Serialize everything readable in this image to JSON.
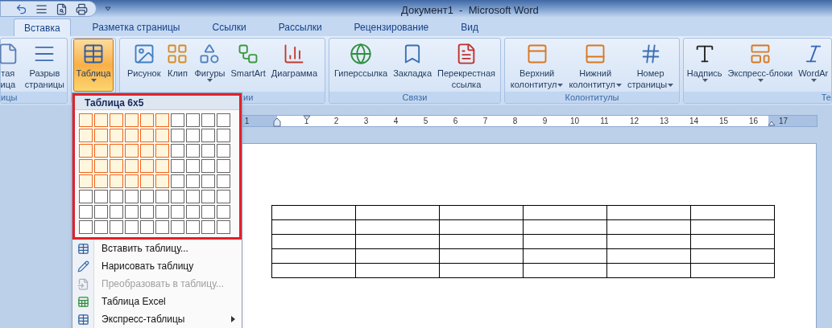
{
  "title_bar": {
    "title": "Документ1  -  Microsoft Word"
  },
  "tabs": [
    {
      "label": "Вставка",
      "selected": true
    },
    {
      "label": "Разметка страницы",
      "selected": false
    },
    {
      "label": "Ссылки",
      "selected": false
    },
    {
      "label": "Рассылки",
      "selected": false
    },
    {
      "label": "Рецензирование",
      "selected": false
    },
    {
      "label": "Вид",
      "selected": false
    }
  ],
  "ribbon": {
    "groups": [
      {
        "label": "ицы",
        "buttons": [
          {
            "lines": [
              "тая",
              "ица"
            ],
            "kind": "plain",
            "pressed": false
          },
          {
            "lines": [
              "Разрыв",
              "страницы"
            ],
            "kind": "plain",
            "pressed": false
          }
        ]
      },
      {
        "buttons": [
          {
            "lines": [
              "Таблица"
            ],
            "kind": "dropdown",
            "pressed": true
          }
        ]
      },
      {
        "label": "ии",
        "buttons": [
          {
            "lines": [
              "Рисунок"
            ],
            "kind": "plain",
            "pressed": false
          },
          {
            "lines": [
              "Клип"
            ],
            "kind": "plain",
            "pressed": false
          },
          {
            "lines": [
              "Фигуры"
            ],
            "kind": "dropdown",
            "pressed": false
          },
          {
            "lines": [
              "SmartArt"
            ],
            "kind": "plain",
            "pressed": false
          },
          {
            "lines": [
              "Диаграмма"
            ],
            "kind": "plain",
            "pressed": false
          }
        ]
      },
      {
        "label": "Связи",
        "buttons": [
          {
            "lines": [
              "Гиперссылка"
            ],
            "kind": "plain",
            "pressed": false
          },
          {
            "lines": [
              "Закладка"
            ],
            "kind": "plain",
            "pressed": false
          },
          {
            "lines": [
              "Перекрестная",
              "ссылка"
            ],
            "kind": "plain",
            "pressed": false
          }
        ]
      },
      {
        "label": "Колонтитулы",
        "buttons": [
          {
            "lines": [
              "Верхний",
              "колонтитул"
            ],
            "kind": "split",
            "pressed": false
          },
          {
            "lines": [
              "Нижний",
              "колонтитул"
            ],
            "kind": "split",
            "pressed": false
          },
          {
            "lines": [
              "Номер",
              "страницы"
            ],
            "kind": "split",
            "pressed": false
          }
        ]
      },
      {
        "label": "Те",
        "buttons": [
          {
            "lines": [
              "Надпись"
            ],
            "kind": "dropdown",
            "pressed": false
          },
          {
            "lines": [
              "Экспресс-блоки"
            ],
            "kind": "dropdown",
            "pressed": false
          },
          {
            "lines": [
              "WordAr"
            ],
            "kind": "dropdown",
            "pressed": false
          }
        ]
      }
    ]
  },
  "ruler": {
    "labels": [
      "1",
      "1",
      "2",
      "3",
      "4",
      "5",
      "6",
      "7",
      "8",
      "9",
      "10",
      "11",
      "12",
      "13",
      "14",
      "15",
      "16",
      "17"
    ]
  },
  "table_menu": {
    "header": "Таблица 6x5",
    "grid_rows": [
      {
        "cells": [
          {
            "selected": true
          },
          {
            "selected": true
          },
          {
            "selected": true
          },
          {
            "selected": true
          },
          {
            "selected": true
          },
          {
            "selected": true
          },
          {
            "selected": false
          },
          {
            "selected": false
          },
          {
            "selected": false
          },
          {
            "selected": false
          }
        ]
      },
      {
        "cells": [
          {
            "selected": true
          },
          {
            "selected": true
          },
          {
            "selected": true
          },
          {
            "selected": true
          },
          {
            "selected": true
          },
          {
            "selected": true
          },
          {
            "selected": false
          },
          {
            "selected": false
          },
          {
            "selected": false
          },
          {
            "selected": false
          }
        ]
      },
      {
        "cells": [
          {
            "selected": true
          },
          {
            "selected": true
          },
          {
            "selected": true
          },
          {
            "selected": true
          },
          {
            "selected": true
          },
          {
            "selected": true
          },
          {
            "selected": false
          },
          {
            "selected": false
          },
          {
            "selected": false
          },
          {
            "selected": false
          }
        ]
      },
      {
        "cells": [
          {
            "selected": true
          },
          {
            "selected": true
          },
          {
            "selected": true
          },
          {
            "selected": true
          },
          {
            "selected": true
          },
          {
            "selected": true
          },
          {
            "selected": false
          },
          {
            "selected": false
          },
          {
            "selected": false
          },
          {
            "selected": false
          }
        ]
      },
      {
        "cells": [
          {
            "selected": true
          },
          {
            "selected": true
          },
          {
            "selected": true
          },
          {
            "selected": true
          },
          {
            "selected": true
          },
          {
            "selected": true
          },
          {
            "selected": false
          },
          {
            "selected": false
          },
          {
            "selected": false
          },
          {
            "selected": false
          }
        ]
      },
      {
        "cells": [
          {
            "selected": false
          },
          {
            "selected": false
          },
          {
            "selected": false
          },
          {
            "selected": false
          },
          {
            "selected": false
          },
          {
            "selected": false
          },
          {
            "selected": false
          },
          {
            "selected": false
          },
          {
            "selected": false
          },
          {
            "selected": false
          }
        ]
      },
      {
        "cells": [
          {
            "selected": false
          },
          {
            "selected": false
          },
          {
            "selected": false
          },
          {
            "selected": false
          },
          {
            "selected": false
          },
          {
            "selected": false
          },
          {
            "selected": false
          },
          {
            "selected": false
          },
          {
            "selected": false
          },
          {
            "selected": false
          }
        ]
      },
      {
        "cells": [
          {
            "selected": false
          },
          {
            "selected": false
          },
          {
            "selected": false
          },
          {
            "selected": false
          },
          {
            "selected": false
          },
          {
            "selected": false
          },
          {
            "selected": false
          },
          {
            "selected": false
          },
          {
            "selected": false
          },
          {
            "selected": false
          }
        ]
      }
    ],
    "items": [
      {
        "label": "Вставить таблицу...",
        "disabled": false,
        "submenu": false
      },
      {
        "label": "Нарисовать таблицу",
        "disabled": false,
        "submenu": false
      },
      {
        "label": "Преобразовать в таблицу...",
        "disabled": true,
        "submenu": false
      },
      {
        "label": "Таблица Excel",
        "disabled": false,
        "submenu": false
      },
      {
        "label": "Экспресс-таблицы",
        "disabled": false,
        "submenu": true
      }
    ]
  },
  "document": {
    "table": {
      "rows": [
        {
          "cells": [
            {
              "kind": "empty"
            },
            {
              "kind": "empty"
            },
            {
              "kind": "empty"
            },
            {
              "kind": "empty"
            },
            {
              "kind": "empty"
            },
            {
              "kind": "empty"
            }
          ]
        },
        {
          "cells": [
            {
              "kind": "empty"
            },
            {
              "kind": "empty"
            },
            {
              "kind": "empty"
            },
            {
              "kind": "empty"
            },
            {
              "kind": "empty"
            },
            {
              "kind": "empty"
            }
          ]
        },
        {
          "cells": [
            {
              "kind": "empty"
            },
            {
              "kind": "empty"
            },
            {
              "kind": "empty"
            },
            {
              "kind": "empty"
            },
            {
              "kind": "empty"
            },
            {
              "kind": "empty"
            }
          ]
        },
        {
          "cells": [
            {
              "kind": "empty"
            },
            {
              "kind": "empty"
            },
            {
              "kind": "empty"
            },
            {
              "kind": "empty"
            },
            {
              "kind": "empty"
            },
            {
              "kind": "empty"
            }
          ]
        },
        {
          "cells": [
            {
              "kind": "empty"
            },
            {
              "kind": "empty"
            },
            {
              "kind": "empty"
            },
            {
              "kind": "empty"
            },
            {
              "kind": "empty"
            },
            {
              "kind": "empty"
            }
          ]
        }
      ]
    }
  }
}
